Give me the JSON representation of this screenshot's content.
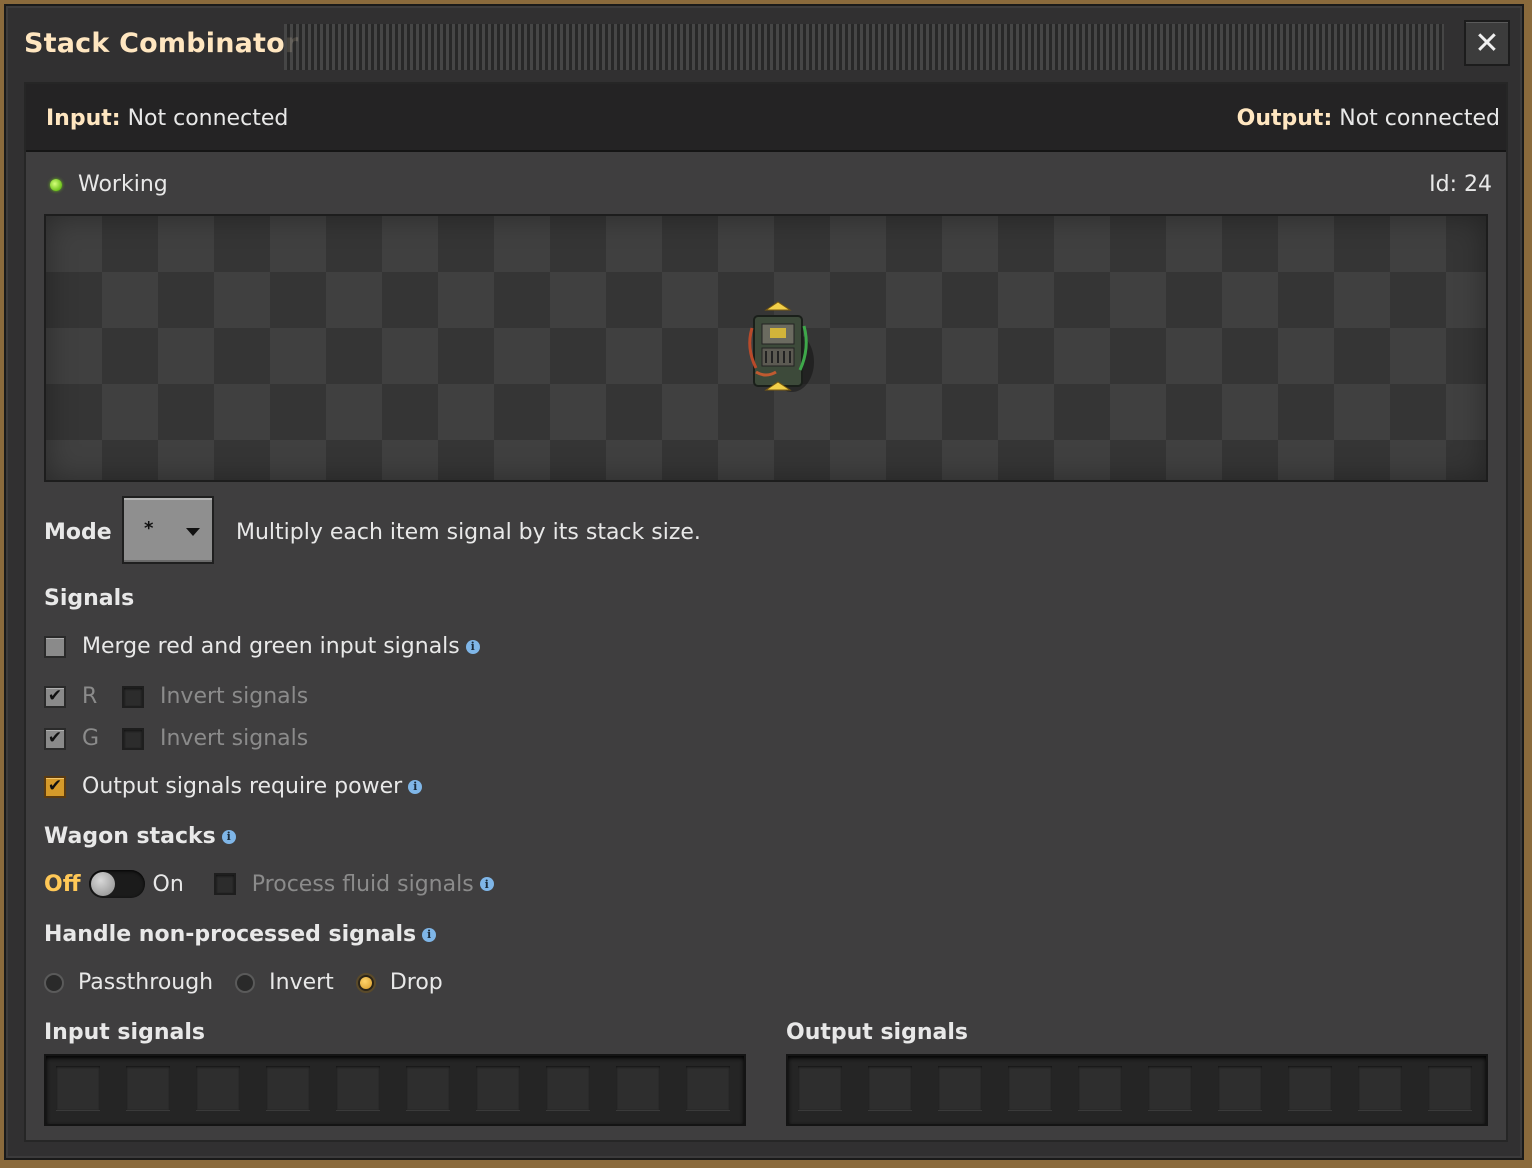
{
  "window": {
    "title": "Stack Combinator",
    "close_glyph": "✕"
  },
  "connections": {
    "input_label": "Input:",
    "input_value": "Not connected",
    "output_label": "Output:",
    "output_value": "Not connected"
  },
  "status": {
    "text": "Working",
    "id_text": "Id: 24",
    "color": "#6ec21c"
  },
  "mode": {
    "label": "Mode",
    "selected": "*",
    "description": "Multiply each item signal by its stack size."
  },
  "signals": {
    "heading": "Signals",
    "merge_label": "Merge red and green input signals",
    "merge_checked": false,
    "r_label": "R",
    "r_checked": true,
    "r_invert_label": "Invert signals",
    "r_invert_checked": false,
    "g_label": "G",
    "g_checked": true,
    "g_invert_label": "Invert signals",
    "g_invert_checked": false,
    "power_label": "Output signals require power",
    "power_checked": true
  },
  "wagon": {
    "heading": "Wagon stacks",
    "off_label": "Off",
    "on_label": "On",
    "state": "off",
    "fluid_label": "Process fluid signals",
    "fluid_checked": false
  },
  "nonprocessed": {
    "heading": "Handle non-processed signals",
    "options": [
      "Passthrough",
      "Invert",
      "Drop"
    ],
    "selected": "Drop"
  },
  "panels": {
    "input_heading": "Input signals",
    "output_heading": "Output signals"
  },
  "icons": [
    "close-icon",
    "status-dot-icon",
    "dropdown-caret-icon",
    "info-icon",
    "checkmark-icon",
    "stack-combinator-entity-icon"
  ],
  "colors": {
    "accent": "#ffe6c0",
    "checkbox_on": "#d59a2a",
    "info": "#7fb6e8"
  }
}
